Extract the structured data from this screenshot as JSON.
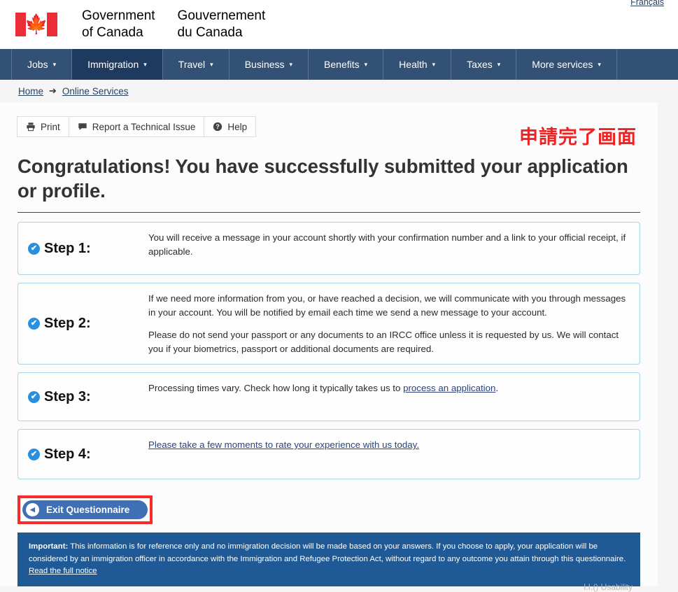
{
  "header": {
    "lang_toggle": "Français",
    "wordmark_en": "Government\nof Canada",
    "wordmark_fr": "Gouvernement\ndu Canada",
    "flag_leaf": "🍁"
  },
  "nav": {
    "items": [
      {
        "label": "Jobs",
        "active": false
      },
      {
        "label": "Immigration",
        "active": true
      },
      {
        "label": "Travel",
        "active": false
      },
      {
        "label": "Business",
        "active": false
      },
      {
        "label": "Benefits",
        "active": false
      },
      {
        "label": "Health",
        "active": false
      },
      {
        "label": "Taxes",
        "active": false
      },
      {
        "label": "More services",
        "active": false
      }
    ],
    "caret": "▾",
    "bg_color": "#335075",
    "active_bg_color": "#1f3a5f"
  },
  "breadcrumb": {
    "home": "Home",
    "arrow": "➔",
    "current": "Online Services"
  },
  "toolbar": {
    "print_label": "Print",
    "report_label": "Report a Technical Issue",
    "help_label": "Help"
  },
  "annotation": {
    "text": "申請完了画面",
    "color": "#ee2222"
  },
  "main": {
    "title": "Congratulations! You have successfully submitted your application or profile.",
    "rule_color": "#8a2433"
  },
  "steps": [
    {
      "label": "Step 1:",
      "paragraphs": [
        "You will receive a message in your account shortly with your confirmation number and a link to your official receipt, if applicable."
      ]
    },
    {
      "label": "Step 2:",
      "paragraphs": [
        "If we need more information from you, or have reached a decision, we will communicate with you through messages in your account. You will be notified by email each time we send a new message to your account.",
        "Please do not send your passport or any documents to an IRCC office unless it is requested by us. We will contact you if your biometrics, passport or additional documents are required."
      ]
    },
    {
      "label": "Step 3:",
      "text_before_link": "Processing times vary. Check how long it typically takes us to ",
      "link_text": "process an application",
      "text_after_link": "."
    },
    {
      "label": "Step 4:",
      "link_text": "Please take a few moments to rate your experience with us today."
    }
  ],
  "exit_button": {
    "label": "Exit Questionnaire",
    "arrow": "◀",
    "highlight_color": "#f92a2a",
    "bg_color": "#3f6fb5"
  },
  "notice": {
    "important_label": "Important:",
    "body": " This information is for reference only and no immigration decision will be made based on your answers. If you choose to apply, your application will be considered by an immigration officer in accordance with the Immigration and Refugee Protection Act, without regard to any outcome you attain through this questionnaire. ",
    "link_text": "Read the full notice",
    "bg_color": "#1f5a96"
  },
  "footer_fragment": "I.I.() Usability"
}
